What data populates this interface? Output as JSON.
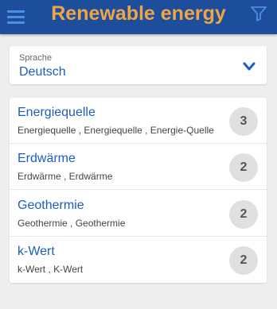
{
  "header": {
    "title": "Renewable energy",
    "menu_icon": "menu-icon",
    "filter_icon": "filter-icon"
  },
  "language": {
    "label": "Sprache",
    "value": "Deutsch"
  },
  "items": [
    {
      "title": "Energiequelle",
      "subtitle": "Energiequelle , Energiequelle , Energie-Quelle",
      "count": "3"
    },
    {
      "title": "Erdwärme",
      "subtitle": "Erdwärme , Erdwärme",
      "count": "2"
    },
    {
      "title": "Geothermie",
      "subtitle": "Geothermie , Geothermie",
      "count": "2"
    },
    {
      "title": "k-Wert",
      "subtitle": "k-Wert , K-Wert",
      "count": "2"
    }
  ],
  "colors": {
    "appbar": "#1d4e9c",
    "title": "#f0a445",
    "link": "#1d5dbf"
  }
}
